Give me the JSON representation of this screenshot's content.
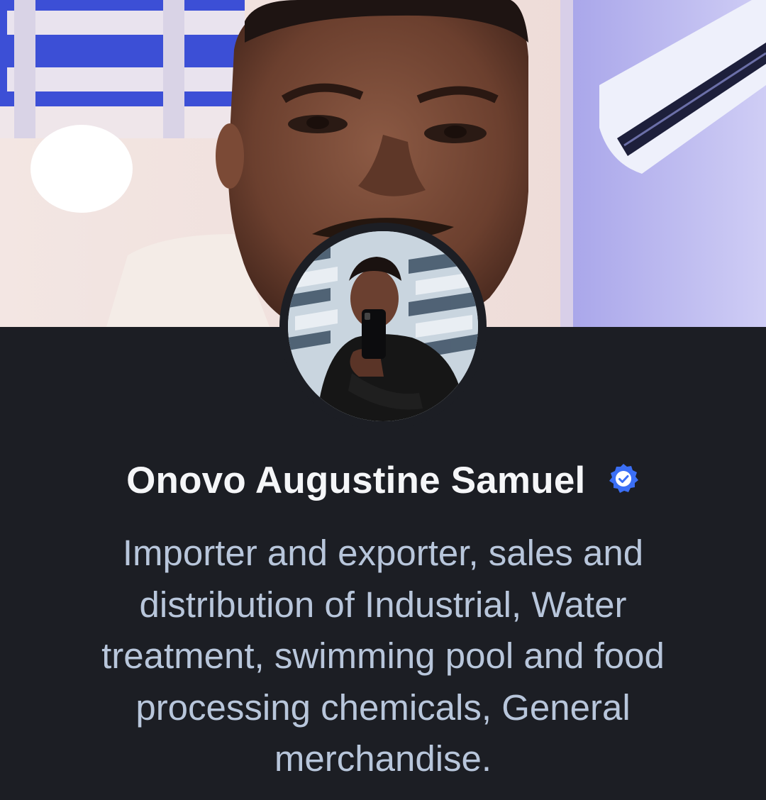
{
  "profile": {
    "name": "Onovo Augustine Samuel",
    "verified": true,
    "bio": "Importer and exporter, sales and distribution of Industrial, Water treatment, swimming pool and food processing chemicals, General merchandise."
  },
  "colors": {
    "background": "#1c1e24",
    "name_text": "#f5f6f8",
    "bio_text": "#b8c6db",
    "verified_badge": "#3b6ff5"
  },
  "icons": {
    "verified": "verified-check-badge-icon"
  }
}
